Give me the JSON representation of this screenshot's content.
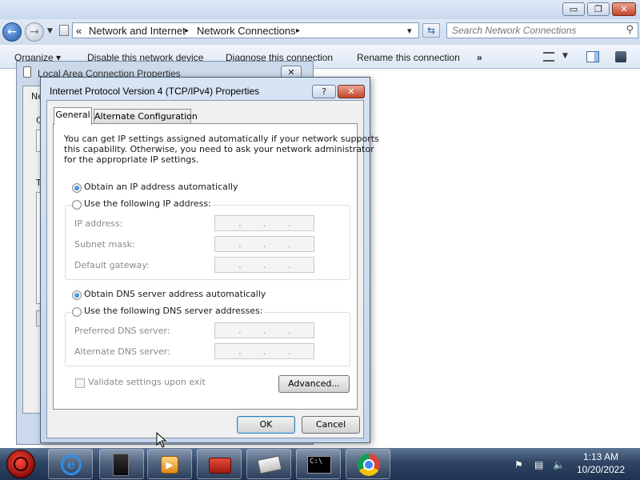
{
  "window": {
    "minimize_glyph": "▭",
    "restore_glyph": "❐",
    "close_glyph": "✕"
  },
  "address": {
    "prefix": "«",
    "crumbs": [
      "Network and Internet",
      "Network Connections"
    ],
    "separator": "▸",
    "dropdown_glyph": "▾",
    "refresh_glyph": "⇆"
  },
  "search": {
    "placeholder": "Search Network Connections"
  },
  "toolbar": {
    "organize": "Organize ▾",
    "disable": "Disable this network device",
    "diagnose": "Diagnose this connection",
    "rename": "Rename this connection",
    "more": "»"
  },
  "background_window": {
    "title": "Local Area Connection Properties",
    "tab_fragment": "Ne",
    "letters": [
      "C",
      "T"
    ]
  },
  "dialog": {
    "title": "Internet Protocol Version 4 (TCP/IPv4) Properties",
    "help_glyph": "?",
    "close_glyph": "✕",
    "tabs": [
      "General",
      "Alternate Configuration"
    ],
    "intro": [
      "You can get IP settings assigned automatically if your network supports",
      "this capability. Otherwise, you need to ask your network administrator",
      "for the appropriate IP settings."
    ],
    "ip_auto": "Obtain an IP address automatically",
    "ip_manual": "Use the following IP address:",
    "ip_fields": [
      "IP address:",
      "Subnet mask:",
      "Default gateway:"
    ],
    "dns_auto": "Obtain DNS server address automatically",
    "dns_manual": "Use the following DNS server addresses:",
    "dns_fields": [
      "Preferred DNS server:",
      "Alternate DNS server:"
    ],
    "validate": "Validate settings upon exit",
    "advanced": "Advanced...",
    "ok": "OK",
    "cancel": "Cancel",
    "ip_dot": "."
  },
  "taskbar": {
    "time": "1:13 AM",
    "date": "10/20/2022",
    "cmd_glyph": "C:\\"
  }
}
